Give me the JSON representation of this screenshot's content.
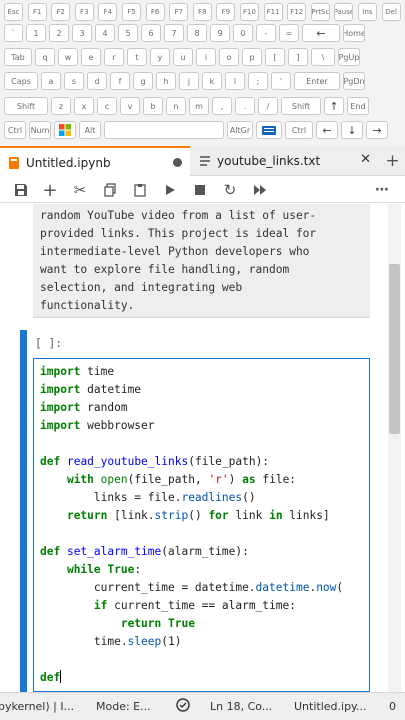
{
  "keyboard": {
    "row1": [
      "Esc",
      "F1",
      "F2",
      "F3",
      "F4",
      "F5",
      "F6",
      "F7",
      "F8",
      "F9",
      "F10",
      "F11",
      "F12",
      "PrtSc",
      "Pause",
      "Ins",
      "Del"
    ],
    "row2": [
      "`",
      "1",
      "2",
      "3",
      "4",
      "5",
      "6",
      "7",
      "8",
      "9",
      "0",
      "-",
      "=",
      "←",
      "Home"
    ],
    "row3": [
      "Tab",
      "q",
      "w",
      "e",
      "r",
      "t",
      "y",
      "u",
      "i",
      "o",
      "p",
      "[",
      "]",
      "\\",
      "PgUp"
    ],
    "row4": [
      "Caps",
      "a",
      "s",
      "d",
      "f",
      "g",
      "h",
      "j",
      "k",
      "l",
      ";",
      "'",
      "Enter",
      "PgDn"
    ],
    "row5": [
      "Shift",
      "z",
      "x",
      "c",
      "v",
      "b",
      "n",
      "m",
      ",",
      ".",
      "/",
      "Shift",
      "↑",
      "End"
    ],
    "row6": [
      "Ctrl",
      "Num",
      "",
      "Alt",
      "",
      "AltGr",
      "",
      "Ctrl",
      "←",
      "↓",
      "→"
    ]
  },
  "tabs": [
    {
      "label": "Untitled.ipynb",
      "icon": "notebook-icon",
      "active": true,
      "unsaved": true
    },
    {
      "label": "youtube_links.txt",
      "icon": "text-file-icon",
      "active": false
    }
  ],
  "new_tab_label": "+",
  "toolbar": {
    "icons": [
      "save-icon",
      "add-cell-icon",
      "cut-icon",
      "copy-icon",
      "paste-icon",
      "run-icon",
      "stop-icon",
      "restart-icon",
      "fast-forward-icon",
      "more-icon"
    ]
  },
  "markdown_cell": {
    "lines": [
      "random YouTube video from a list of user-",
      "provided links. This project is ideal for",
      "intermediate-level Python developers who",
      "want to explore file handling, random",
      "selection, and integrating web",
      "functionality."
    ]
  },
  "code_cell": {
    "prompt": "[ ]:",
    "lines": [
      [
        [
          "kw",
          "import"
        ],
        [
          "t",
          " time"
        ]
      ],
      [
        [
          "kw",
          "import"
        ],
        [
          "t",
          " datetime"
        ]
      ],
      [
        [
          "kw",
          "import"
        ],
        [
          "t",
          " random"
        ]
      ],
      [
        [
          "kw",
          "import"
        ],
        [
          "t",
          " webbrowser"
        ]
      ],
      [],
      [
        [
          "kw",
          "def"
        ],
        [
          "t",
          " "
        ],
        [
          "fn",
          "read_youtube_links"
        ],
        [
          "t",
          "(file_path):"
        ]
      ],
      [
        [
          "t",
          "    "
        ],
        [
          "kw",
          "with"
        ],
        [
          "t",
          " "
        ],
        [
          "kw2",
          "open"
        ],
        [
          "t",
          "(file_path, "
        ],
        [
          "st",
          "'r'"
        ],
        [
          "t",
          ") "
        ],
        [
          "kw",
          "as"
        ],
        [
          "t",
          " file:"
        ]
      ],
      [
        [
          "t",
          "        links = file."
        ],
        [
          "at",
          "readlines"
        ],
        [
          "t",
          "()"
        ]
      ],
      [
        [
          "t",
          "    "
        ],
        [
          "kw",
          "return"
        ],
        [
          "t",
          " [link."
        ],
        [
          "at",
          "strip"
        ],
        [
          "t",
          "() "
        ],
        [
          "kw",
          "for"
        ],
        [
          "t",
          " link "
        ],
        [
          "kw",
          "in"
        ],
        [
          "t",
          " links]"
        ]
      ],
      [],
      [
        [
          "kw",
          "def"
        ],
        [
          "t",
          " "
        ],
        [
          "fn",
          "set_alarm_time"
        ],
        [
          "t",
          "(alarm_time):"
        ]
      ],
      [
        [
          "t",
          "    "
        ],
        [
          "kw",
          "while"
        ],
        [
          "t",
          " "
        ],
        [
          "kw",
          "True"
        ],
        [
          "t",
          ":"
        ]
      ],
      [
        [
          "t",
          "        current_time = datetime."
        ],
        [
          "at",
          "datetime"
        ],
        [
          "t",
          "."
        ],
        [
          "at",
          "now"
        ],
        [
          "t",
          "("
        ]
      ],
      [
        [
          "t",
          "        "
        ],
        [
          "kw",
          "if"
        ],
        [
          "t",
          " current_time == alarm_time:"
        ]
      ],
      [
        [
          "t",
          "            "
        ],
        [
          "kw",
          "return"
        ],
        [
          "t",
          " "
        ],
        [
          "kw",
          "True"
        ]
      ],
      [
        [
          "t",
          "        time."
        ],
        [
          "at",
          "sleep"
        ],
        [
          "t",
          "(1)"
        ]
      ],
      [],
      [
        [
          "kw",
          "def"
        ],
        [
          "caret",
          ""
        ]
      ]
    ]
  },
  "status": {
    "kernel": "pykernel) | I...",
    "mode": "Mode: E...",
    "cursor": "Ln 18, Co...",
    "file": "Untitled.ipy...",
    "count": "0"
  }
}
